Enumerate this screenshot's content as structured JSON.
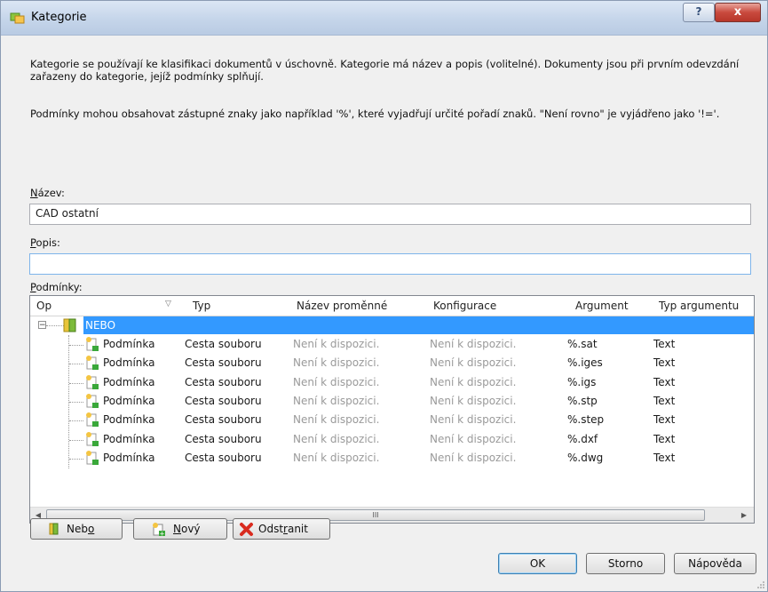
{
  "window": {
    "title": "Kategorie",
    "help_glyph": "?",
    "close_glyph": "x"
  },
  "intro": {
    "paragraph1": "Kategorie se používají ke klasifikaci dokumentů v úschovně. Kategorie má název a popis (volitelné). Dokumenty jsou při prvním odevzdání zařazeny do kategorie, jejíž podmínky splňují.",
    "paragraph2": "Podmínky mohou obsahovat zástupné znaky jako například '%', které vyjadřují určité pořadí znaků. \"Není rovno\" je vyjádřeno jako '!='."
  },
  "fields": {
    "name_label_accel": "N",
    "name_label_rest": "ázev:",
    "name_value": "CAD ostatní",
    "desc_label_accel": "P",
    "desc_label_rest": "opis:",
    "desc_value": "",
    "conditions_label_accel": "P",
    "conditions_label_rest": "odmínky:"
  },
  "grid": {
    "columns": [
      "Op",
      "Typ",
      "Název proměnné",
      "Konfigurace",
      "Argument",
      "Typ argumentu"
    ],
    "group": {
      "label": "NEBO",
      "expander": "−"
    },
    "rows": [
      {
        "op": "Podmínka",
        "type": "Cesta souboru",
        "variable": "Není k dispozici.",
        "config": "Není k dispozici.",
        "argument": "%.sat",
        "arg_type": "Text"
      },
      {
        "op": "Podmínka",
        "type": "Cesta souboru",
        "variable": "Není k dispozici.",
        "config": "Není k dispozici.",
        "argument": "%.iges",
        "arg_type": "Text"
      },
      {
        "op": "Podmínka",
        "type": "Cesta souboru",
        "variable": "Není k dispozici.",
        "config": "Není k dispozici.",
        "argument": "%.igs",
        "arg_type": "Text"
      },
      {
        "op": "Podmínka",
        "type": "Cesta souboru",
        "variable": "Není k dispozici.",
        "config": "Není k dispozici.",
        "argument": "%.stp",
        "arg_type": "Text"
      },
      {
        "op": "Podmínka",
        "type": "Cesta souboru",
        "variable": "Není k dispozici.",
        "config": "Není k dispozici.",
        "argument": "%.step",
        "arg_type": "Text"
      },
      {
        "op": "Podmínka",
        "type": "Cesta souboru",
        "variable": "Není k dispozici.",
        "config": "Není k dispozici.",
        "argument": "%.dxf",
        "arg_type": "Text"
      },
      {
        "op": "Podmínka",
        "type": "Cesta souboru",
        "variable": "Není k dispozici.",
        "config": "Není k dispozici.",
        "argument": "%.dwg",
        "arg_type": "Text"
      }
    ],
    "scroll_left": "◀",
    "scroll_right": "▶",
    "scroll_thumb_grip": "III"
  },
  "actions": {
    "or_pre": "Neb",
    "or_accel": "o",
    "or_post": "",
    "new_pre": "",
    "new_accel": "N",
    "new_post": "ový",
    "remove_pre": "Odst",
    "remove_accel": "r",
    "remove_post": "anit"
  },
  "footer": {
    "ok": "OK",
    "cancel": "Storno",
    "help": "Nápověda"
  },
  "colors": {
    "selection": "#3399ff",
    "muted_text": "#9a9a9a",
    "close_button": "#c94a3e"
  }
}
